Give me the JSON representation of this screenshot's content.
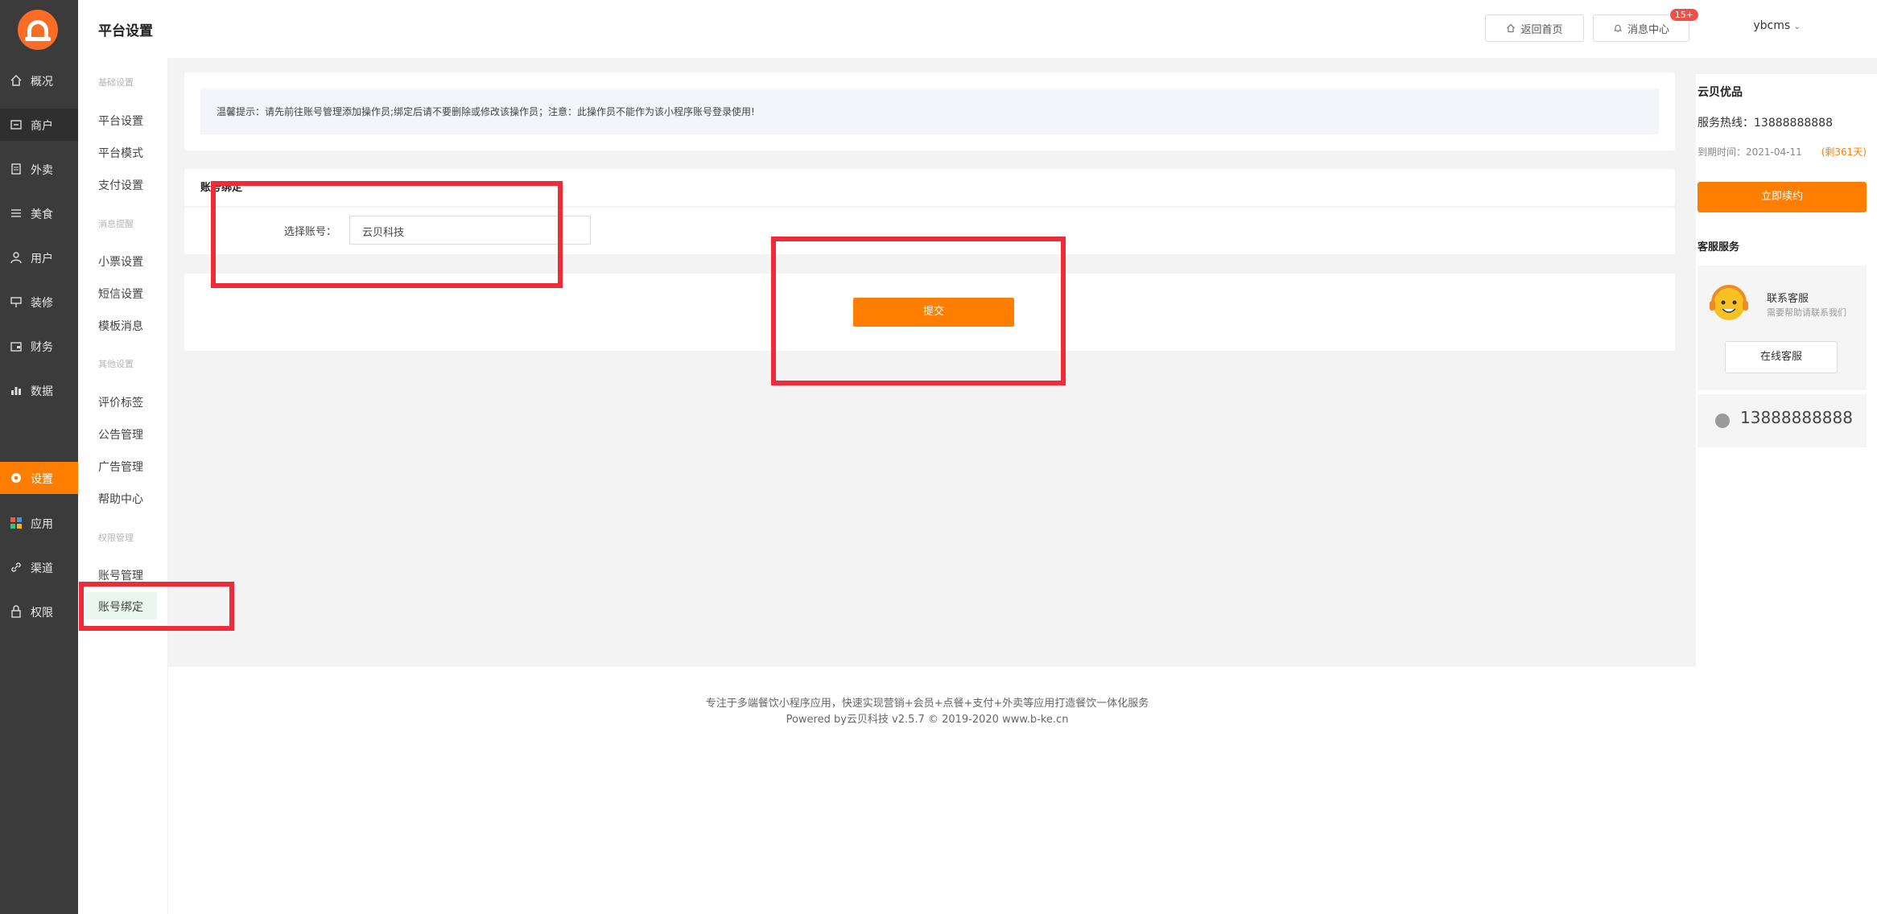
{
  "logo": {
    "icon": "logo-icon"
  },
  "nav": [
    {
      "label": "概况",
      "icon": "home-icon"
    },
    {
      "label": "商户",
      "icon": "store-icon"
    },
    {
      "label": "外卖",
      "icon": "document-icon"
    },
    {
      "label": "美食",
      "icon": "menu-icon"
    },
    {
      "label": "用户",
      "icon": "user-icon"
    },
    {
      "label": "装修",
      "icon": "decor-icon"
    },
    {
      "label": "财务",
      "icon": "wallet-icon"
    },
    {
      "label": "数据",
      "icon": "bar-chart-icon"
    },
    {
      "label": "设置",
      "icon": "gear-icon"
    },
    {
      "label": "应用",
      "icon": "apps-icon"
    },
    {
      "label": "渠道",
      "icon": "link-icon"
    },
    {
      "label": "权限",
      "icon": "lock-icon"
    }
  ],
  "sub": {
    "groups": [
      "基础设置",
      "消息提醒",
      "其他设置",
      "权限管理"
    ],
    "items": [
      "平台设置",
      "平台模式",
      "支付设置",
      "小票设置",
      "短信设置",
      "模板消息",
      "评价标签",
      "公告管理",
      "广告管理",
      "帮助中心",
      "账号管理",
      "账号绑定"
    ]
  },
  "header": {
    "title": "平台设置",
    "home_label": "返回首页",
    "msg_label": "消息中心",
    "msg_badge": "15+",
    "user": "ybcms"
  },
  "main": {
    "tip": "温馨提示：请先前往账号管理添加操作员;绑定后请不要删除或修改该操作员；注意：此操作员不能作为该小程序账号登录使用!",
    "section_title": "账号绑定",
    "account_label": "选择账号：",
    "account_value": "云贝科技",
    "submit_label": "提交"
  },
  "right": {
    "title": "云贝优品",
    "hotline": "服务热线：13888888888",
    "expire": "到期时间：2021-04-11",
    "days": "(剩361天)",
    "renew_label": "立即续约",
    "service_title": "客服服务",
    "contact_name": "联系客服",
    "contact_sub": "需要帮助请联系我们",
    "online_label": "在线客服",
    "phone": "13888888888"
  },
  "footer": {
    "line1": "专注于多端餐饮小程序应用，快速实现营销+会员+点餐+支付+外卖等应用打造餐饮一体化服务",
    "line2": "Powered by云贝科技 v2.5.7 © 2019-2020 www.b-ke.cn"
  },
  "colors": {
    "accent": "#ff7e00",
    "highlight": "#ef2b3a",
    "nav_bg": "#3b3b3b"
  }
}
